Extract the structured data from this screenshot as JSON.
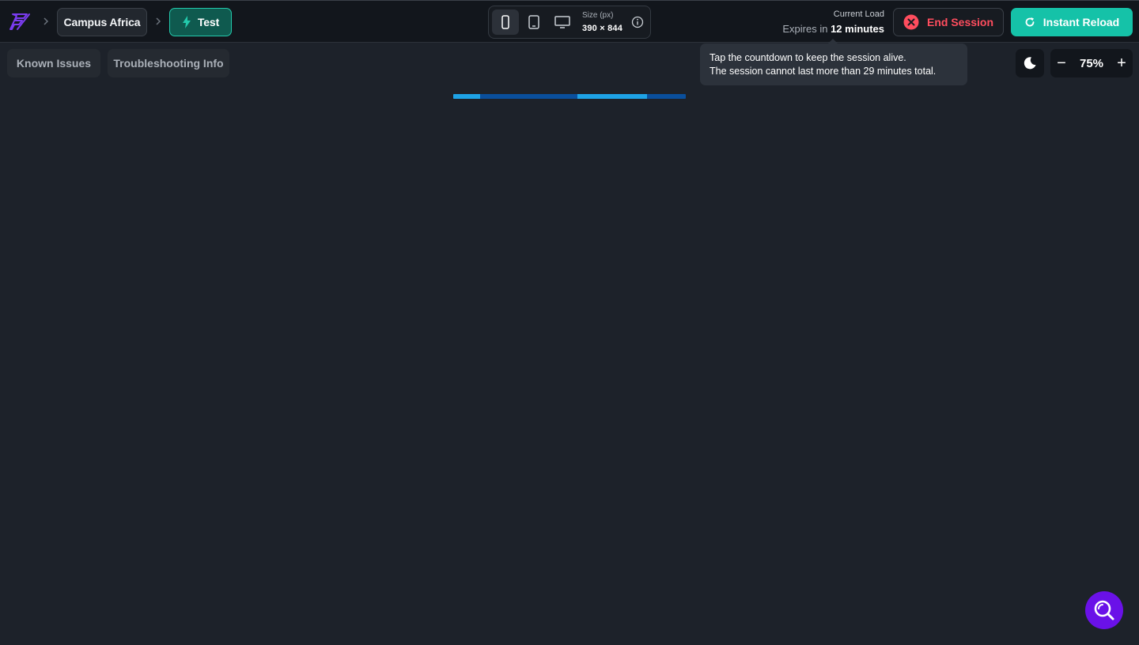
{
  "header": {
    "project_label": "Campus Africa",
    "branch_label": "Test",
    "device_selector": {
      "devices": [
        "mobile-icon",
        "tablet-icon",
        "desktop-icon"
      ],
      "active_device": "mobile",
      "size_label": "Size (px)",
      "size_value": "390 × 844"
    },
    "load": {
      "label": "Current Load",
      "expires_prefix": "Expires in",
      "expires_value": "12 minutes"
    },
    "end_session_label": "End Session",
    "instant_reload_label": "Instant Reload"
  },
  "toolbar": {
    "known_issues_label": "Known Issues",
    "troubleshooting_label": "Troubleshooting Info",
    "zoom_value": "75%",
    "zoom_minus": "−",
    "zoom_plus": "+"
  },
  "tooltip": {
    "line1": "Tap the countdown to keep the session alive.",
    "line2": "The session cannot last more than 29 minutes total."
  },
  "colors": {
    "accent_teal": "#15c2a8",
    "danger": "#ff4d5e",
    "brand_purple": "#6a11e8",
    "background": "#1d222a"
  },
  "loading_progress": 0.85
}
